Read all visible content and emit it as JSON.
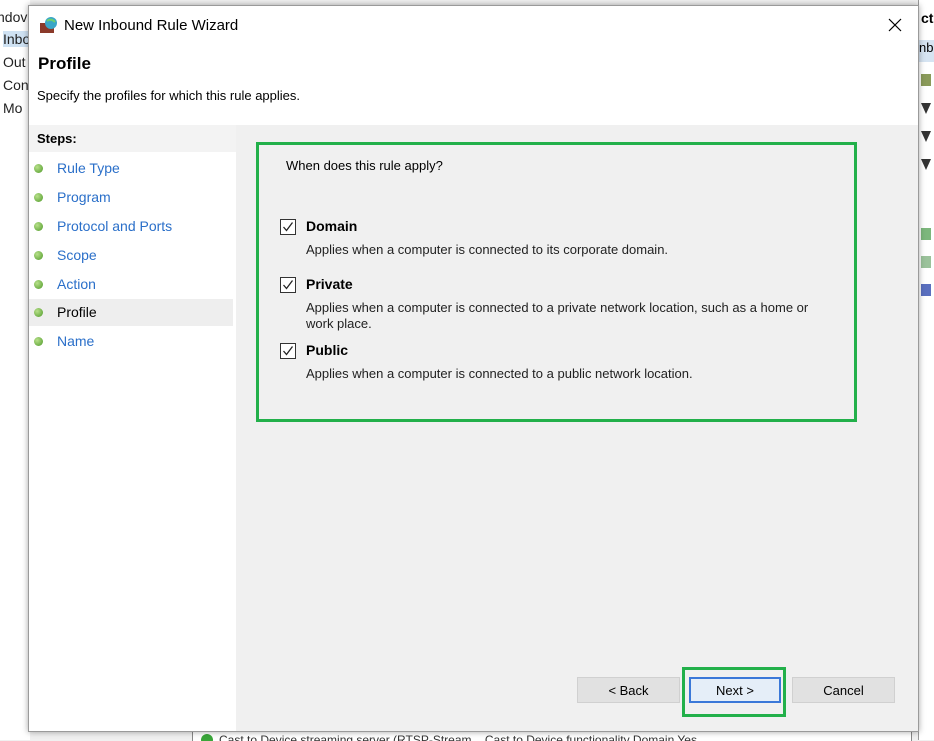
{
  "background": {
    "left_items": [
      "ndov",
      "Inbo",
      "Out",
      "Con",
      "Mo"
    ],
    "right_header": "cti",
    "right_subheader": "nbo",
    "bottom_row": "Cast to Device streaming server (RTSP-Stream... Cast to Device functionality  Domain  Yes"
  },
  "dialog": {
    "title": "New Inbound Rule Wizard",
    "header_title": "Profile",
    "header_description": "Specify the profiles for which this rule applies.",
    "steps_label": "Steps:",
    "steps": [
      {
        "label": "Rule Type",
        "active": false
      },
      {
        "label": "Program",
        "active": false
      },
      {
        "label": "Protocol and Ports",
        "active": false
      },
      {
        "label": "Scope",
        "active": false
      },
      {
        "label": "Action",
        "active": false
      },
      {
        "label": "Profile",
        "active": true
      },
      {
        "label": "Name",
        "active": false
      }
    ],
    "question": "When does this rule apply?",
    "options": [
      {
        "name": "Domain",
        "checked": true,
        "description": "Applies when a computer is connected to its corporate domain."
      },
      {
        "name": "Private",
        "checked": true,
        "description": "Applies when a computer is connected to a private network location, such as a home or work place."
      },
      {
        "name": "Public",
        "checked": true,
        "description": "Applies when a computer is connected to a public network location."
      }
    ],
    "buttons": {
      "back": "< Back",
      "next": "Next >",
      "cancel": "Cancel"
    },
    "highlight_color": "#22b04a",
    "link_color": "#2a6fc9"
  }
}
